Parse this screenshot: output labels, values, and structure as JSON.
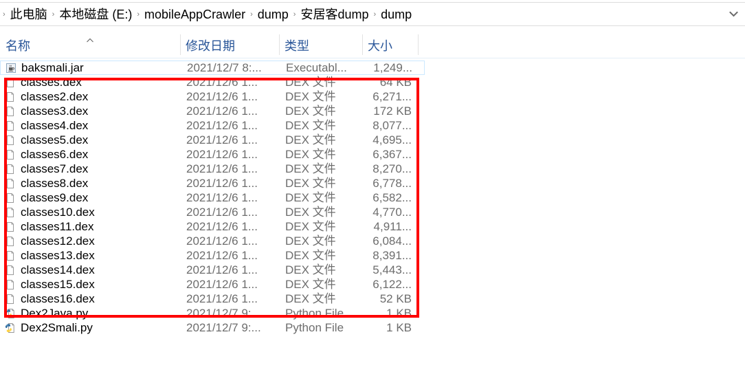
{
  "window": {
    "background_color": "#ffffff"
  },
  "addressbar": {
    "crumbs": [
      {
        "label": "此电脑"
      },
      {
        "label": "本地磁盘 (E:)"
      },
      {
        "label": "mobileAppCrawler"
      },
      {
        "label": "dump"
      },
      {
        "label": "安居客dump"
      },
      {
        "label": "dump"
      }
    ],
    "separator": "›",
    "dropdown_icon": "chevron-down-icon"
  },
  "columns": {
    "name": "名称",
    "date": "修改日期",
    "type": "类型",
    "size": "大小",
    "sort_indicator": "caret-up-icon",
    "sort_column": "名称",
    "header_color": "#2a5699"
  },
  "annotation": {
    "color": "#fe0000",
    "shape": "rectangle",
    "covers_from": "classes.dex",
    "covers_to": "Dex2Java.py"
  },
  "files": [
    {
      "name": "baksmali.jar",
      "date": "2021/12/7 8:...",
      "type": "Executabl...",
      "size": "1,249...",
      "icon": "java-jar-icon",
      "focused": true
    },
    {
      "name": "classes.dex",
      "date": "2021/12/6 1...",
      "type": "DEX 文件",
      "size": "64 KB",
      "icon": "blank-document-icon",
      "focused": false
    },
    {
      "name": "classes2.dex",
      "date": "2021/12/6 1...",
      "type": "DEX 文件",
      "size": "6,271...",
      "icon": "blank-document-icon",
      "focused": false
    },
    {
      "name": "classes3.dex",
      "date": "2021/12/6 1...",
      "type": "DEX 文件",
      "size": "172 KB",
      "icon": "blank-document-icon",
      "focused": false
    },
    {
      "name": "classes4.dex",
      "date": "2021/12/6 1...",
      "type": "DEX 文件",
      "size": "8,077...",
      "icon": "blank-document-icon",
      "focused": false
    },
    {
      "name": "classes5.dex",
      "date": "2021/12/6 1...",
      "type": "DEX 文件",
      "size": "4,695...",
      "icon": "blank-document-icon",
      "focused": false
    },
    {
      "name": "classes6.dex",
      "date": "2021/12/6 1...",
      "type": "DEX 文件",
      "size": "6,367...",
      "icon": "blank-document-icon",
      "focused": false
    },
    {
      "name": "classes7.dex",
      "date": "2021/12/6 1...",
      "type": "DEX 文件",
      "size": "8,270...",
      "icon": "blank-document-icon",
      "focused": false
    },
    {
      "name": "classes8.dex",
      "date": "2021/12/6 1...",
      "type": "DEX 文件",
      "size": "6,778...",
      "icon": "blank-document-icon",
      "focused": false
    },
    {
      "name": "classes9.dex",
      "date": "2021/12/6 1...",
      "type": "DEX 文件",
      "size": "6,582...",
      "icon": "blank-document-icon",
      "focused": false
    },
    {
      "name": "classes10.dex",
      "date": "2021/12/6 1...",
      "type": "DEX 文件",
      "size": "4,770...",
      "icon": "blank-document-icon",
      "focused": false
    },
    {
      "name": "classes11.dex",
      "date": "2021/12/6 1...",
      "type": "DEX 文件",
      "size": "4,911...",
      "icon": "blank-document-icon",
      "focused": false
    },
    {
      "name": "classes12.dex",
      "date": "2021/12/6 1...",
      "type": "DEX 文件",
      "size": "6,084...",
      "icon": "blank-document-icon",
      "focused": false
    },
    {
      "name": "classes13.dex",
      "date": "2021/12/6 1...",
      "type": "DEX 文件",
      "size": "8,391...",
      "icon": "blank-document-icon",
      "focused": false
    },
    {
      "name": "classes14.dex",
      "date": "2021/12/6 1...",
      "type": "DEX 文件",
      "size": "5,443...",
      "icon": "blank-document-icon",
      "focused": false
    },
    {
      "name": "classes15.dex",
      "date": "2021/12/6 1...",
      "type": "DEX 文件",
      "size": "6,122...",
      "icon": "blank-document-icon",
      "focused": false
    },
    {
      "name": "classes16.dex",
      "date": "2021/12/6 1...",
      "type": "DEX 文件",
      "size": "52 KB",
      "icon": "blank-document-icon",
      "focused": false
    },
    {
      "name": "Dex2Java.py",
      "date": "2021/12/7 9:...",
      "type": "Python File",
      "size": "1 KB",
      "icon": "python-file-icon",
      "focused": false
    },
    {
      "name": "Dex2Smali.py",
      "date": "2021/12/7 9:...",
      "type": "Python File",
      "size": "1 KB",
      "icon": "python-file-icon",
      "focused": false
    }
  ]
}
